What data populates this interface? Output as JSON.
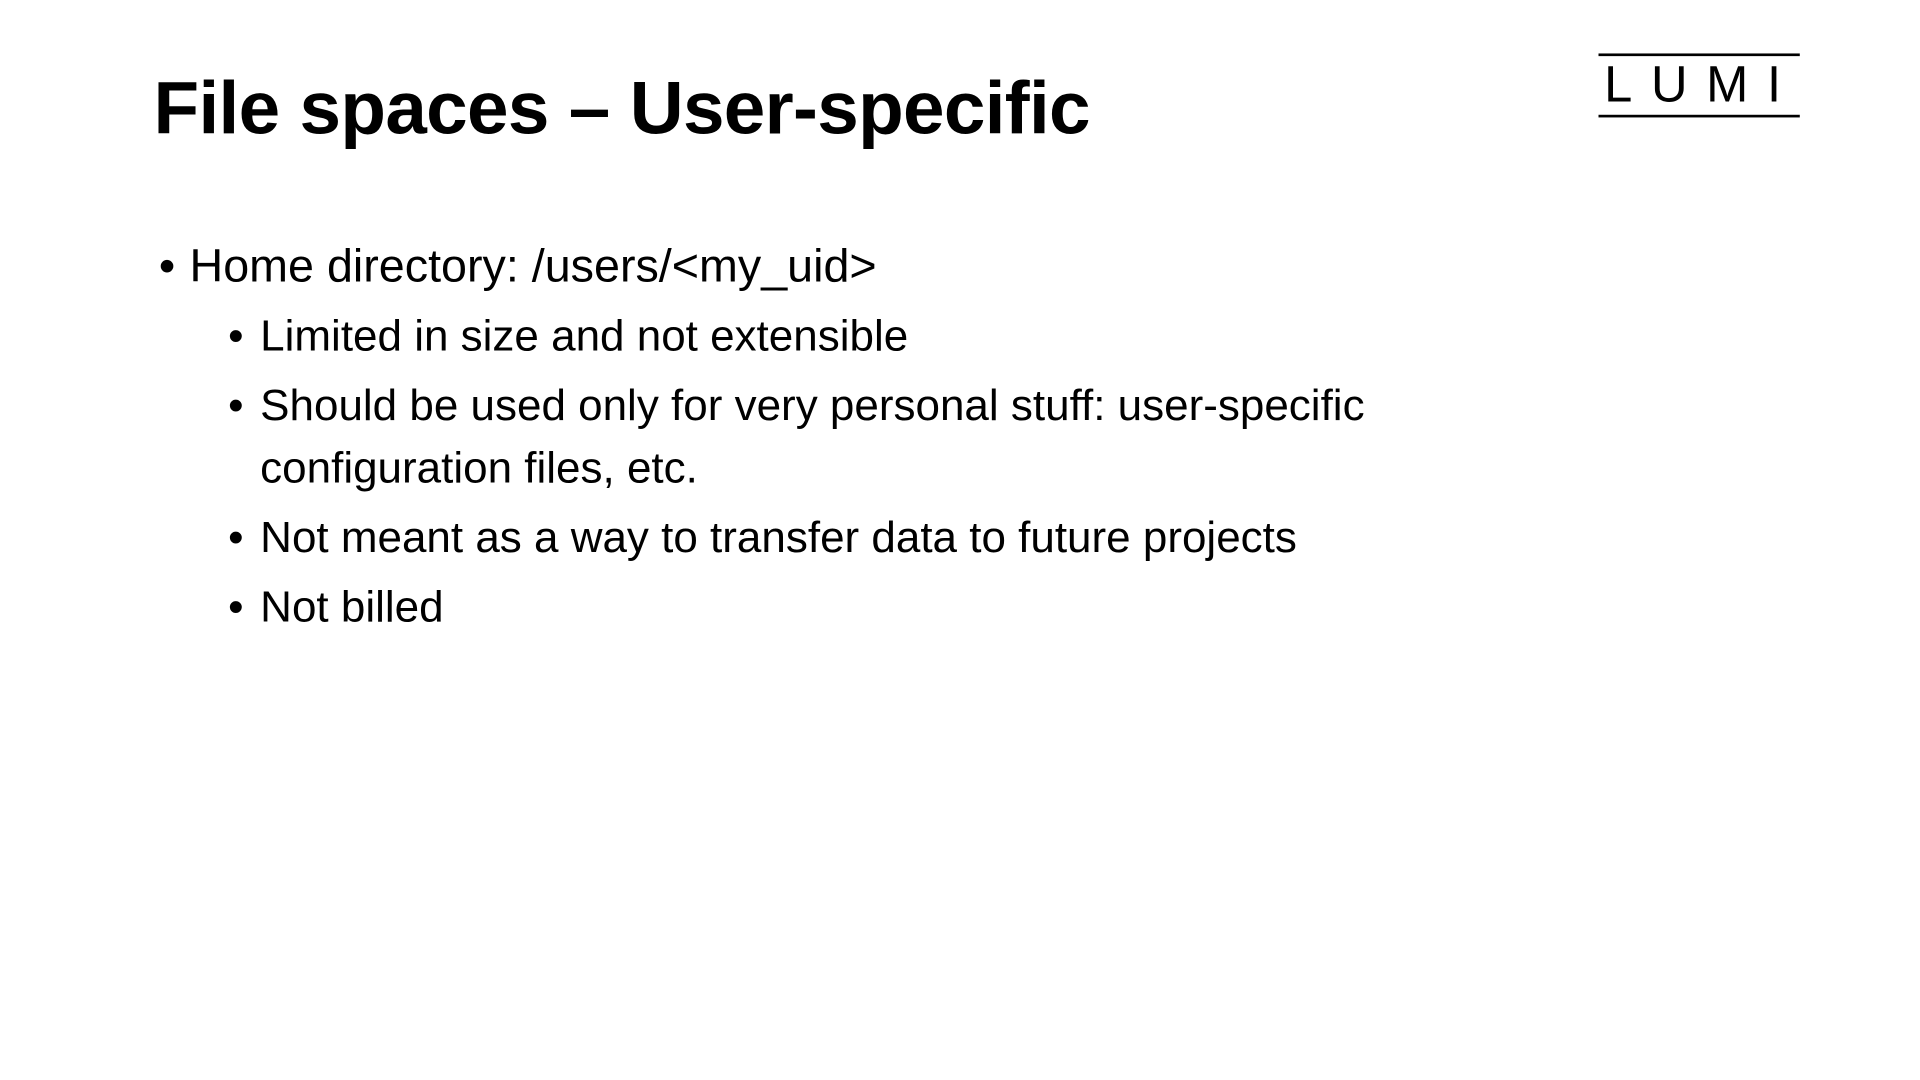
{
  "logo": "LUMI",
  "title": "File spaces – User-specific",
  "content": {
    "main_bullet": "Home directory: /users/<my_uid>",
    "sub_bullets": [
      "Limited in size and not extensible",
      "Should be used only for very personal stuff: user-specific configuration files, etc.",
      "Not meant as a way to transfer data to future projects",
      "Not billed"
    ]
  }
}
